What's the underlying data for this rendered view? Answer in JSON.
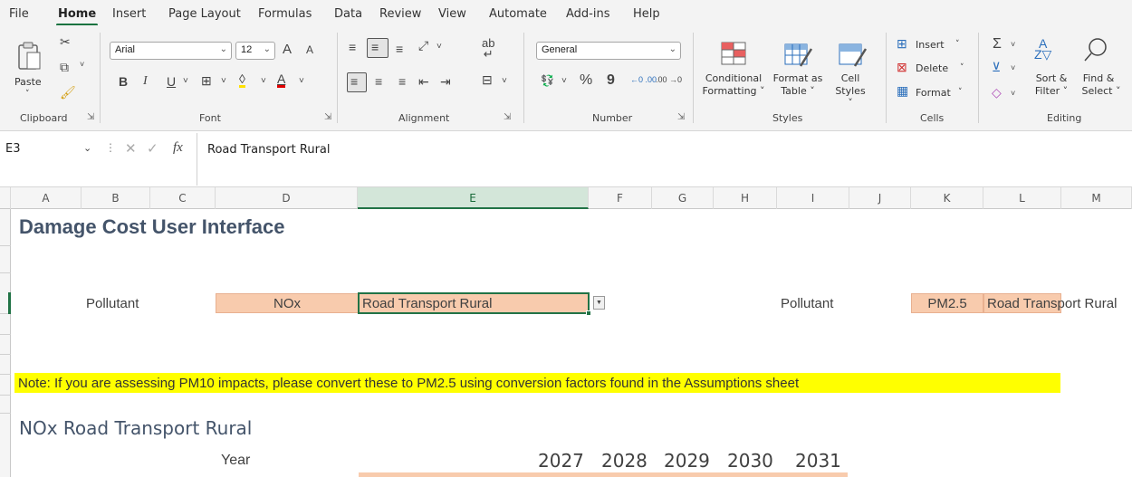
{
  "menu": {
    "items": [
      "File",
      "Home",
      "Insert",
      "Page Layout",
      "Formulas",
      "Data",
      "Review",
      "View",
      "Automate",
      "Add-ins",
      "Help"
    ],
    "active": "Home"
  },
  "ribbon": {
    "clipboard": {
      "label": "Clipboard",
      "paste": "Paste"
    },
    "font": {
      "label": "Font",
      "name": "Arial",
      "size": "12",
      "bold": "B",
      "italic": "I",
      "underline": "U",
      "grow": "A",
      "shrink": "A"
    },
    "alignment": {
      "label": "Alignment"
    },
    "number": {
      "label": "Number",
      "format": "General",
      "percent": "%",
      "comma": "9",
      "inc_dec": "←0 .00",
      "dec_dec": ".00 →0"
    },
    "styles": {
      "label": "Styles",
      "conditional": [
        "Conditional",
        "Formatting ˅"
      ],
      "format_table": [
        "Format as",
        "Table ˅"
      ],
      "cell_styles": [
        "Cell",
        "Styles ˅"
      ]
    },
    "cells": {
      "label": "Cells",
      "insert": "Insert",
      "delete": "Delete",
      "format": "Format"
    },
    "editing": {
      "label": "Editing",
      "sort": [
        "Sort &",
        "Filter ˅"
      ],
      "find": [
        "Find &",
        "Select ˅"
      ]
    }
  },
  "formula_bar": {
    "name_box": "E3",
    "fx": "fx",
    "content": "Road Transport Rural"
  },
  "columns": [
    "A",
    "B",
    "C",
    "D",
    "E",
    "F",
    "G",
    "H",
    "I",
    "J",
    "K",
    "L",
    "M"
  ],
  "sheet": {
    "title": "Damage Cost User Interface",
    "pollutant_label": "Pollutant",
    "pollutant_1": "NOx",
    "source_1": "Road Transport Rural",
    "pollutant_label_2": "Pollutant",
    "pollutant_2": "PM2.5",
    "source_2": "Road Transport Rural",
    "note": "Note: If you are assessing PM10 impacts, please convert these to PM2.5 using conversion factors found in the Assumptions sheet",
    "subtitle": "NOx Road Transport Rural",
    "year_label": "Year",
    "years": [
      "2027",
      "2028",
      "2029",
      "2030",
      "2031"
    ]
  },
  "colors": {
    "accent": "#217346",
    "input_fill": "#f8cbad",
    "note_fill": "#ffff00",
    "title": "#44546a"
  }
}
